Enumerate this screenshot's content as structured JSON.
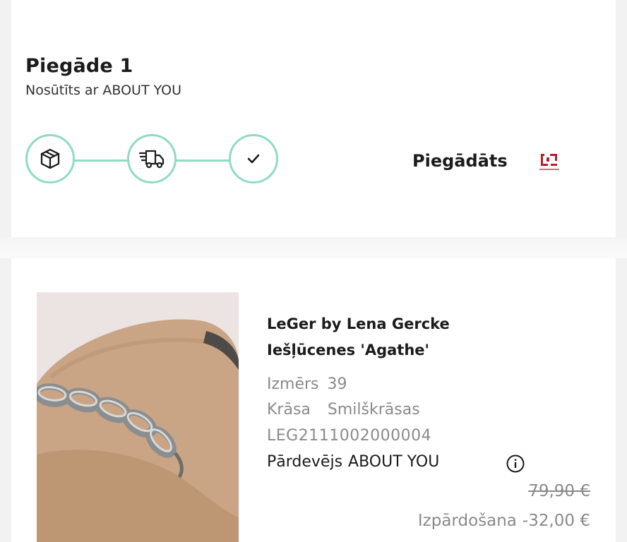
{
  "delivery": {
    "title": "Piegāde 1",
    "subtitle": "Nosūtīts ar ABOUT YOU",
    "status": "Piegādāts",
    "steps": [
      {
        "icon": "package-icon",
        "completed": true
      },
      {
        "icon": "delivery-truck-icon",
        "completed": true
      },
      {
        "icon": "checkmark-icon",
        "completed": true
      }
    ],
    "carrier_logo_icon": "carrier-logo-icon"
  },
  "product": {
    "brand": "LeGer by Lena Gercke",
    "name": "Iešļūcenes 'Agathe'",
    "size_label": "Izmērs",
    "size_value": "39",
    "color_label": "Krāsa",
    "color_value": "Smilškrāsas",
    "sku": "LEG2111002000004",
    "seller_label": "Pārdevējs",
    "seller_value": "ABOUT YOU",
    "original_price": "79,90 €",
    "sale_label": "Izpārdošana",
    "sale_discount": "-32,00 €"
  },
  "colors": {
    "tracker_accent": "#8fdcc0",
    "text_primary": "#1b1b1b",
    "text_muted": "#8a8a8a",
    "carrier_logo": "#b7202e",
    "product_suede": "#c9a585"
  }
}
